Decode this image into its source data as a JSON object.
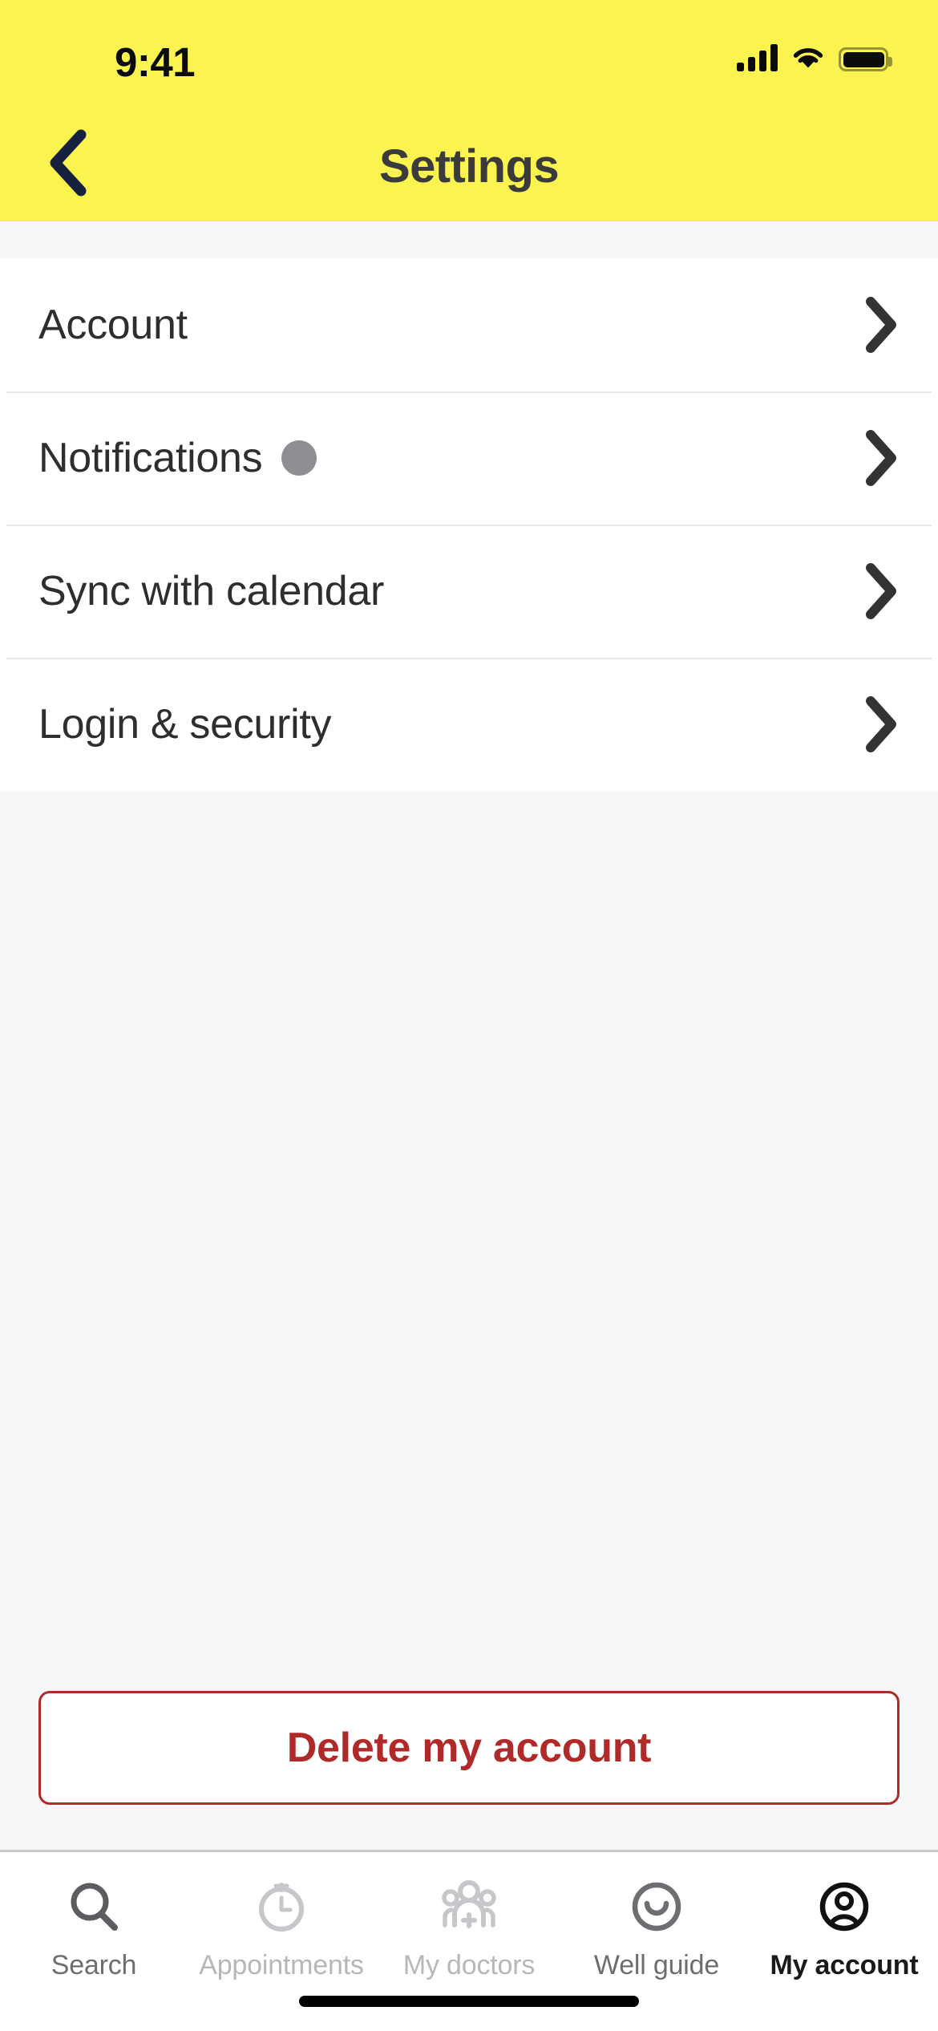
{
  "status_bar": {
    "time": "9:41",
    "cellular_icon": "cellular-signal-icon",
    "wifi_icon": "wifi-icon",
    "battery_icon": "battery-full-icon"
  },
  "header": {
    "title": "Settings",
    "back_icon": "chevron-left-icon",
    "background_color": "#fbf450",
    "title_color": "#3b3b3b",
    "back_icon_color": "#16213f"
  },
  "settings_list": {
    "rows": [
      {
        "label": "Account",
        "badge": false,
        "chevron_icon": "chevron-right-icon"
      },
      {
        "label": "Notifications",
        "badge": true,
        "badge_color": "#8e8e93",
        "chevron_icon": "chevron-right-icon"
      },
      {
        "label": "Sync with calendar",
        "badge": false,
        "chevron_icon": "chevron-right-icon"
      },
      {
        "label": "Login & security",
        "badge": false,
        "chevron_icon": "chevron-right-icon"
      }
    ]
  },
  "delete_account": {
    "label": "Delete my account",
    "color": "#b02a2a"
  },
  "tab_bar": {
    "tabs": [
      {
        "label": "Search",
        "icon": "search-icon",
        "state": "mid"
      },
      {
        "label": "Appointments",
        "icon": "stopwatch-icon",
        "state": "dim"
      },
      {
        "label": "My doctors",
        "icon": "doctors-group-icon",
        "state": "dim"
      },
      {
        "label": "Well guide",
        "icon": "smile-circle-icon",
        "state": "mid"
      },
      {
        "label": "My account",
        "icon": "person-circle-icon",
        "state": "active"
      }
    ]
  },
  "home_indicator": {
    "name": "home-indicator"
  }
}
